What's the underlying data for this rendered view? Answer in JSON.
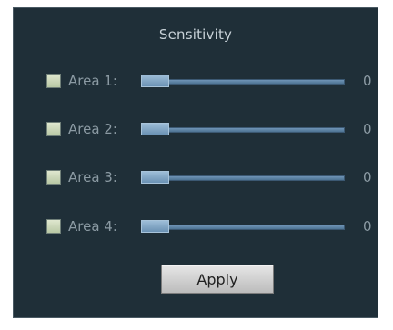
{
  "panel": {
    "title": "Sensitivity"
  },
  "areas": [
    {
      "label": "Area 1:",
      "value": "0",
      "checked": false
    },
    {
      "label": "Area 2:",
      "value": "0",
      "checked": false
    },
    {
      "label": "Area 3:",
      "value": "0",
      "checked": false
    },
    {
      "label": "Area 4:",
      "value": "0",
      "checked": false
    }
  ],
  "apply_label": "Apply",
  "colors": {
    "panel_background": "#1f2f38",
    "label_text": "#8b9aa3",
    "slider_track": "#5b82a3",
    "slider_thumb": "#8ab0cf",
    "checkbox_fill": "#cfdbc0"
  }
}
